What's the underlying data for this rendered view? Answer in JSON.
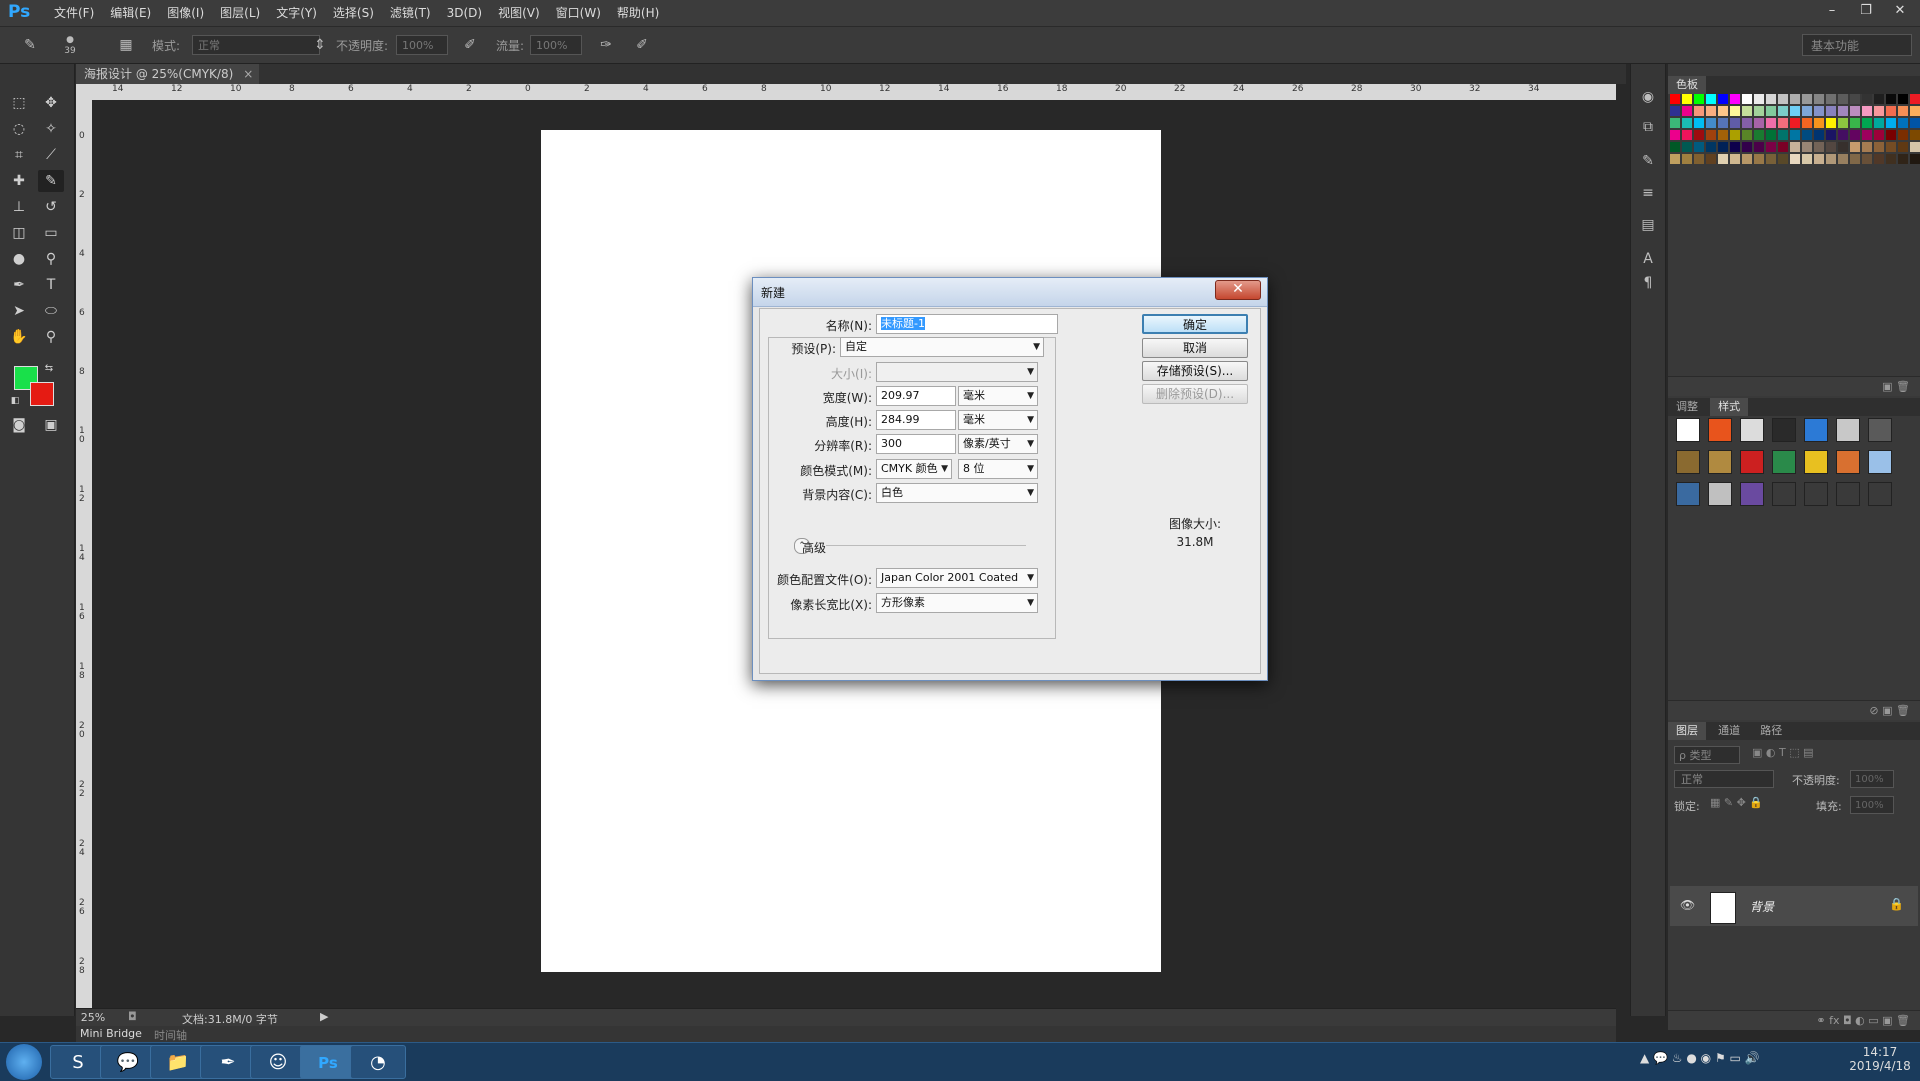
{
  "app": {
    "logo": "Ps",
    "menus": [
      "文件(F)",
      "编辑(E)",
      "图像(I)",
      "图层(L)",
      "文字(Y)",
      "选择(S)",
      "滤镜(T)",
      "3D(D)",
      "视图(V)",
      "窗口(W)",
      "帮助(H)"
    ],
    "window_controls": [
      "–",
      "❐",
      "✕"
    ]
  },
  "options_bar": {
    "brush_size": "39",
    "mode_label": "模式:",
    "mode_value": "正常",
    "opacity_label": "不透明度:",
    "opacity_value": "100%",
    "flow_label": "流量:",
    "flow_value": "100%",
    "workspace": "基本功能"
  },
  "document_tab": {
    "title": "海报设计 @ 25%(CMYK/8)",
    "close": "×"
  },
  "ruler": {
    "h_labels": [
      "14",
      "12",
      "10",
      "8",
      "6",
      "4",
      "2",
      "0",
      "2",
      "4",
      "6",
      "8",
      "10",
      "12",
      "14",
      "16",
      "18",
      "20",
      "22",
      "24",
      "26",
      "28",
      "30",
      "32",
      "34"
    ],
    "v_labels": [
      "0",
      "2",
      "4",
      "6",
      "8",
      "1 0",
      "1 2",
      "1 4",
      "1 6",
      "1 8",
      "2 0",
      "2 2",
      "2 4",
      "2 6",
      "2 8"
    ]
  },
  "status": {
    "zoom": "25%",
    "doc_info": "文档:31.8M/0 字节",
    "bottom_tabs": [
      "Mini Bridge",
      "时间轴"
    ]
  },
  "panels": {
    "swatches_tab": "色板",
    "styles_tabs": [
      "调整",
      "样式"
    ],
    "layers_tabs": [
      "图层",
      "通道",
      "路径"
    ],
    "layer_filter": "ρ 类型",
    "blend_mode": "正常",
    "opacity_label": "不透明度:",
    "opacity_value": "100%",
    "lock_label": "锁定:",
    "fill_label": "填充:",
    "fill_value": "100%",
    "layer_name": "背景"
  },
  "swatch_colors": [
    "#ff0000",
    "#ffff00",
    "#00ff00",
    "#00ffff",
    "#0000ff",
    "#ff00ff",
    "#ffffff",
    "#ebebeb",
    "#d6d6d6",
    "#c2c2c2",
    "#adadad",
    "#999999",
    "#858585",
    "#707070",
    "#5c5c5c",
    "#474747",
    "#333333",
    "#1f1f1f",
    "#0a0a0a",
    "#000000",
    "#ed1c24",
    "#fff200",
    "#00a651",
    "#00aeef",
    "#2e3192",
    "#ec008c",
    "#f7977a",
    "#f9ad81",
    "#fdc68a",
    "#fff79a",
    "#c4df9b",
    "#a3d39c",
    "#82ca9d",
    "#7bcdc8",
    "#6ecff6",
    "#7ea7d8",
    "#8493ca",
    "#8882be",
    "#a187be",
    "#bc8dbf",
    "#f49ac2",
    "#f6989d",
    "#f26c4f",
    "#f68e55",
    "#fbaf5c",
    "#fff467",
    "#acd372",
    "#7cc576",
    "#3bb878",
    "#1abbb4",
    "#00bff3",
    "#438ccb",
    "#5574b9",
    "#605ca8",
    "#855fa8",
    "#a763a8",
    "#f06eaa",
    "#f26d7d",
    "#ed1c24",
    "#f26522",
    "#f7941d",
    "#fff200",
    "#8dc73f",
    "#39b54a",
    "#00a651",
    "#00a99d",
    "#00aeef",
    "#0072bc",
    "#0054a6",
    "#2e3192",
    "#662d91",
    "#92278f",
    "#ec008c",
    "#ed145b",
    "#9e0b0f",
    "#a0410d",
    "#a36209",
    "#aba000",
    "#598527",
    "#1a7b30",
    "#007236",
    "#00746b",
    "#0076a3",
    "#004b80",
    "#003471",
    "#1b1464",
    "#440e62",
    "#630460",
    "#9e005d",
    "#9e0039",
    "#790000",
    "#7b2e00",
    "#7d4900",
    "#827b00",
    "#406618",
    "#005e20",
    "#005826",
    "#005952",
    "#005b7f",
    "#003663",
    "#002157",
    "#0d004c",
    "#32004b",
    "#4b0049",
    "#7b0046",
    "#7a0026",
    "#c7b299",
    "#998675",
    "#736357",
    "#534741",
    "#37302d",
    "#c69c6d",
    "#a67c52",
    "#8c6239",
    "#754c24",
    "#603913",
    "#d4c4a8",
    "#b59a76",
    "#8a7053",
    "#5d4b36",
    "#c0a060",
    "#a08040",
    "#806030",
    "#604020",
    "#e0d0b0",
    "#d0b890",
    "#b89868",
    "#987848",
    "#786038",
    "#584828",
    "#e8d8c0",
    "#d8c8a8",
    "#c8b090",
    "#b09878",
    "#988060",
    "#806848",
    "#685038",
    "#503828",
    "#403020",
    "#302418",
    "#201810",
    "#181008",
    "#100800",
    "#080400"
  ],
  "style_colors": [
    "#ffffff",
    "#e8541c",
    "#dcdcdc",
    "#2a2a2a",
    "#2c7ad6",
    "#c8c8c8",
    "#5a5a5a",
    "#8a6a30",
    "#b08a40",
    "#cc2020",
    "#2a8a4a",
    "#e8c020",
    "#d87030",
    "#9ac0e8",
    "#3a6aa0",
    "#c0c0c0",
    "#6a4aa0",
    "#3a3a3a",
    "#3a3a3a",
    "#3a3a3a",
    "#3a3a3a"
  ],
  "dialog": {
    "title": "新建",
    "close": "✕",
    "name_label": "名称(N):",
    "name_value": "未标题-1",
    "preset_label": "预设(P):",
    "preset_value": "自定",
    "size_label": "大小(I):",
    "size_value": "",
    "width_label": "宽度(W):",
    "width_value": "209.97",
    "width_unit": "毫米",
    "height_label": "高度(H):",
    "height_value": "284.99",
    "height_unit": "毫米",
    "res_label": "分辨率(R):",
    "res_value": "300",
    "res_unit": "像素/英寸",
    "color_mode_label": "颜色模式(M):",
    "color_mode_value": "CMYK 颜色",
    "bit_depth": "8 位",
    "bg_label": "背景内容(C):",
    "bg_value": "白色",
    "advanced_label": "高级",
    "profile_label": "颜色配置文件(O):",
    "profile_value": "Japan Color 2001 Coated",
    "pixel_aspect_label": "像素长宽比(X):",
    "pixel_aspect_value": "方形像素",
    "ok": "确定",
    "cancel": "取消",
    "save_preset": "存储预设(S)...",
    "delete_preset": "删除预设(D)...",
    "image_size_label": "图像大小:",
    "image_size_value": "31.8M"
  },
  "taskbar": {
    "time": "14:17",
    "date": "2019/4/18",
    "apps": [
      "start",
      "sogou",
      "wechat",
      "explorer",
      "pen",
      "avatar",
      "Ps",
      "glasses"
    ]
  }
}
